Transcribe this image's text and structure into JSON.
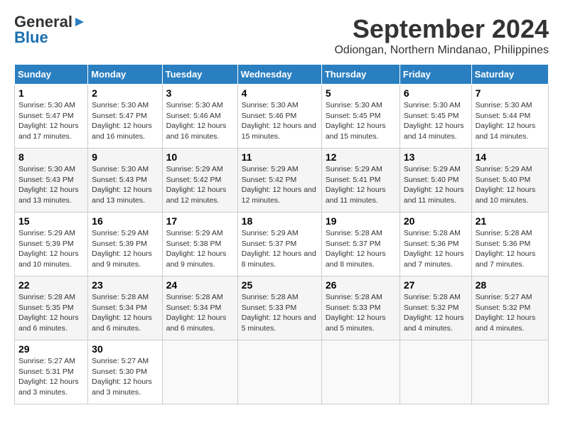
{
  "header": {
    "logo_line1": "General",
    "logo_line2": "Blue",
    "month": "September 2024",
    "location": "Odiongan, Northern Mindanao, Philippines"
  },
  "weekdays": [
    "Sunday",
    "Monday",
    "Tuesday",
    "Wednesday",
    "Thursday",
    "Friday",
    "Saturday"
  ],
  "weeks": [
    [
      {
        "day": 1,
        "sunrise": "5:30 AM",
        "sunset": "5:47 PM",
        "daylight": "12 hours and 17 minutes."
      },
      {
        "day": 2,
        "sunrise": "5:30 AM",
        "sunset": "5:47 PM",
        "daylight": "12 hours and 16 minutes."
      },
      {
        "day": 3,
        "sunrise": "5:30 AM",
        "sunset": "5:46 AM",
        "daylight": "12 hours and 16 minutes."
      },
      {
        "day": 4,
        "sunrise": "5:30 AM",
        "sunset": "5:46 PM",
        "daylight": "12 hours and 15 minutes."
      },
      {
        "day": 5,
        "sunrise": "5:30 AM",
        "sunset": "5:45 PM",
        "daylight": "12 hours and 15 minutes."
      },
      {
        "day": 6,
        "sunrise": "5:30 AM",
        "sunset": "5:45 PM",
        "daylight": "12 hours and 14 minutes."
      },
      {
        "day": 7,
        "sunrise": "5:30 AM",
        "sunset": "5:44 PM",
        "daylight": "12 hours and 14 minutes."
      }
    ],
    [
      {
        "day": 8,
        "sunrise": "5:30 AM",
        "sunset": "5:43 PM",
        "daylight": "12 hours and 13 minutes."
      },
      {
        "day": 9,
        "sunrise": "5:30 AM",
        "sunset": "5:43 PM",
        "daylight": "12 hours and 13 minutes."
      },
      {
        "day": 10,
        "sunrise": "5:29 AM",
        "sunset": "5:42 PM",
        "daylight": "12 hours and 12 minutes."
      },
      {
        "day": 11,
        "sunrise": "5:29 AM",
        "sunset": "5:42 PM",
        "daylight": "12 hours and 12 minutes."
      },
      {
        "day": 12,
        "sunrise": "5:29 AM",
        "sunset": "5:41 PM",
        "daylight": "12 hours and 11 minutes."
      },
      {
        "day": 13,
        "sunrise": "5:29 AM",
        "sunset": "5:40 PM",
        "daylight": "12 hours and 11 minutes."
      },
      {
        "day": 14,
        "sunrise": "5:29 AM",
        "sunset": "5:40 PM",
        "daylight": "12 hours and 10 minutes."
      }
    ],
    [
      {
        "day": 15,
        "sunrise": "5:29 AM",
        "sunset": "5:39 PM",
        "daylight": "12 hours and 10 minutes."
      },
      {
        "day": 16,
        "sunrise": "5:29 AM",
        "sunset": "5:39 PM",
        "daylight": "12 hours and 9 minutes."
      },
      {
        "day": 17,
        "sunrise": "5:29 AM",
        "sunset": "5:38 PM",
        "daylight": "12 hours and 9 minutes."
      },
      {
        "day": 18,
        "sunrise": "5:29 AM",
        "sunset": "5:37 PM",
        "daylight": "12 hours and 8 minutes."
      },
      {
        "day": 19,
        "sunrise": "5:28 AM",
        "sunset": "5:37 PM",
        "daylight": "12 hours and 8 minutes."
      },
      {
        "day": 20,
        "sunrise": "5:28 AM",
        "sunset": "5:36 PM",
        "daylight": "12 hours and 7 minutes."
      },
      {
        "day": 21,
        "sunrise": "5:28 AM",
        "sunset": "5:36 PM",
        "daylight": "12 hours and 7 minutes."
      }
    ],
    [
      {
        "day": 22,
        "sunrise": "5:28 AM",
        "sunset": "5:35 PM",
        "daylight": "12 hours and 6 minutes."
      },
      {
        "day": 23,
        "sunrise": "5:28 AM",
        "sunset": "5:34 PM",
        "daylight": "12 hours and 6 minutes."
      },
      {
        "day": 24,
        "sunrise": "5:28 AM",
        "sunset": "5:34 PM",
        "daylight": "12 hours and 6 minutes."
      },
      {
        "day": 25,
        "sunrise": "5:28 AM",
        "sunset": "5:33 PM",
        "daylight": "12 hours and 5 minutes."
      },
      {
        "day": 26,
        "sunrise": "5:28 AM",
        "sunset": "5:33 PM",
        "daylight": "12 hours and 5 minutes."
      },
      {
        "day": 27,
        "sunrise": "5:28 AM",
        "sunset": "5:32 PM",
        "daylight": "12 hours and 4 minutes."
      },
      {
        "day": 28,
        "sunrise": "5:27 AM",
        "sunset": "5:32 PM",
        "daylight": "12 hours and 4 minutes."
      }
    ],
    [
      {
        "day": 29,
        "sunrise": "5:27 AM",
        "sunset": "5:31 PM",
        "daylight": "12 hours and 3 minutes."
      },
      {
        "day": 30,
        "sunrise": "5:27 AM",
        "sunset": "5:30 PM",
        "daylight": "12 hours and 3 minutes."
      },
      null,
      null,
      null,
      null,
      null
    ]
  ]
}
